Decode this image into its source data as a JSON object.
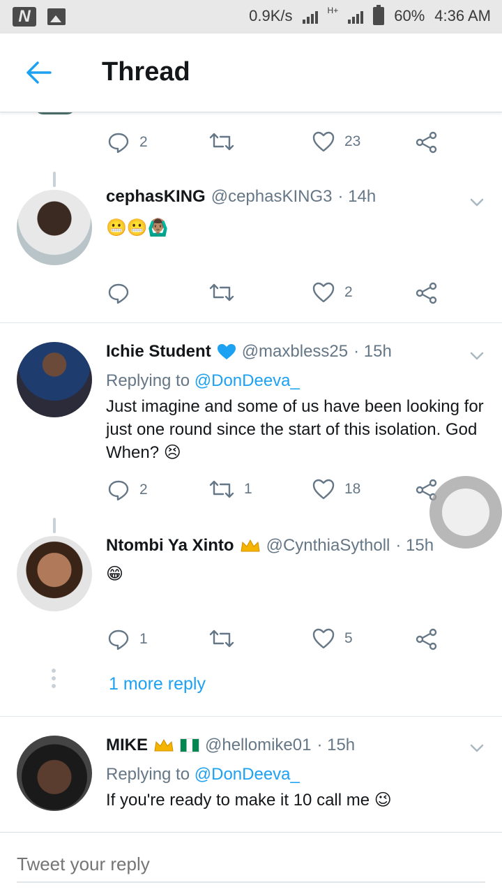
{
  "status_bar": {
    "network_speed": "0.9K/s",
    "network_type": "H+",
    "battery": "60%",
    "time": "4:36 AM"
  },
  "header": {
    "title": "Thread"
  },
  "top_actions": {
    "reply_count": "2",
    "retweet_count": "",
    "like_count": "23"
  },
  "tweets": [
    {
      "name": "cephasKING",
      "handle": "@cephasKING3",
      "time": "· 14h",
      "text": "😬😬🙆🏽‍♂",
      "reply_count": "",
      "retweet_count": "",
      "like_count": "2"
    },
    {
      "name": "Ichie Student",
      "handle": "@maxbless25",
      "time": "· 15h",
      "replying_prefix": "Replying to",
      "replying_to": "@DonDeeva_",
      "text": "Just imagine and some of us have been looking for just one round since the start of this isolation. God When? 😣",
      "reply_count": "2",
      "retweet_count": "1",
      "like_count": "18"
    },
    {
      "name": "Ntombi Ya Xinto",
      "handle": "@CynthiaSytholl",
      "time": "· 15h",
      "text": "😁",
      "reply_count": "1",
      "retweet_count": "",
      "like_count": "5"
    },
    {
      "name": "MIKE",
      "handle": "@hellomike01",
      "time": "· 15h",
      "replying_prefix": "Replying to",
      "replying_to": "@DonDeeva_",
      "text": "If you're ready to make it 10 call me 😉"
    }
  ],
  "more_replies": "1 more reply",
  "reply_bar": {
    "placeholder": "Tweet your reply"
  },
  "colors": {
    "accent": "#1da1f2",
    "muted": "#657786",
    "text": "#14171a",
    "verified": "#1da1f2"
  }
}
